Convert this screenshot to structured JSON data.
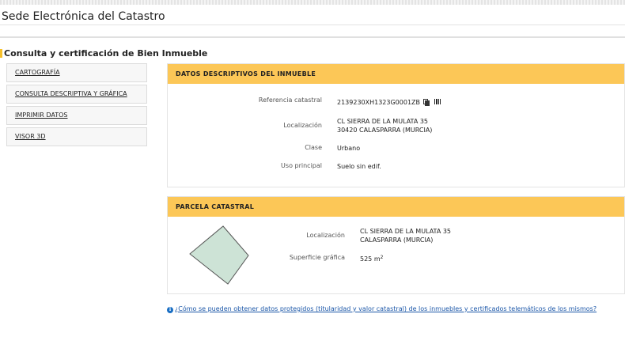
{
  "site": {
    "title": "Sede Electrónica del Catastro"
  },
  "page": {
    "title": "Consulta y certificación de Bien Inmueble"
  },
  "sidebar": {
    "items": [
      {
        "label": "CARTOGRAFÍA"
      },
      {
        "label": "CONSULTA DESCRIPTIVA Y GRÁFICA"
      },
      {
        "label": "IMPRIMIR DATOS"
      },
      {
        "label": "VISOR 3D"
      }
    ]
  },
  "inmueble": {
    "header": "DATOS DESCRIPTIVOS DEL INMUEBLE",
    "ref_label": "Referencia catastral",
    "ref_value": "2139230XH1323G0001ZB",
    "loc_label": "Localización",
    "loc_line1": "CL SIERRA DE LA MULATA 35",
    "loc_line2": "30420 CALASPARRA (MURCIA)",
    "clase_label": "Clase",
    "clase_value": "Urbano",
    "uso_label": "Uso principal",
    "uso_value": "Suelo sin edif."
  },
  "parcela": {
    "header": "PARCELA CATASTRAL",
    "loc_label": "Localización",
    "loc_line1": "CL SIERRA DE LA MULATA 35",
    "loc_line2": "CALASPARRA (MURCIA)",
    "sup_label": "Superficie gráfica",
    "sup_value": "525 m",
    "sup_unit_exp": "2",
    "shape_fill": "#cde3d6",
    "shape_stroke": "#555555"
  },
  "footer": {
    "info_glyph": "i",
    "link_text": "¿Cómo se pueden obtener datos protegidos (titularidad y valor catastral) de los inmuebles y certificados telemáticos de los mismos?"
  },
  "colors": {
    "accent": "#fcc757",
    "link": "#1a56a8"
  }
}
